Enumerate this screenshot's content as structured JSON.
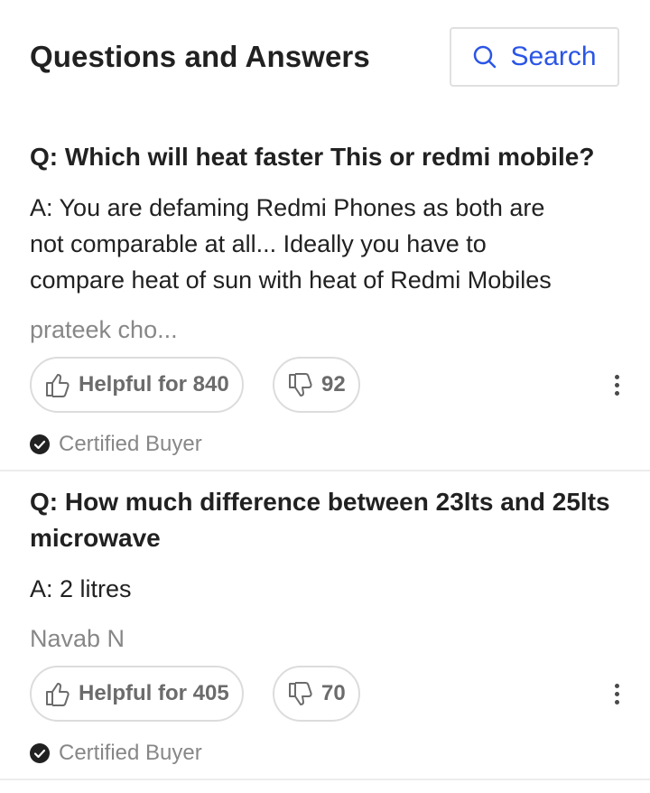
{
  "header": {
    "title": "Questions and Answers",
    "search_label": "Search"
  },
  "qa": [
    {
      "question": "Q: Which will heat faster This or redmi mobile?",
      "answer_lines": [
        "A: You are defaming Redmi Phones as both are",
        "not comparable at all... Ideally you have to",
        "compare heat of sun with heat of Redmi Mobiles"
      ],
      "author": "prateek cho...",
      "helpful_label": "Helpful for 840",
      "dislike_count": "92",
      "certified_label": "Certified Buyer"
    },
    {
      "question_lines": [
        "Q: How much difference between 23lts and 25lts",
        "microwave"
      ],
      "answer": "A: 2 litres",
      "author": "Navab N",
      "helpful_label": "Helpful for 405",
      "dislike_count": "70",
      "certified_label": "Certified Buyer"
    }
  ],
  "colors": {
    "accent": "#2a55e5",
    "text_primary": "#212121",
    "text_secondary": "#878787",
    "border": "#dcdcdc"
  },
  "icons": {
    "search": "search-icon",
    "helpful": "thumbs-up-icon",
    "dislike": "thumbs-down-icon",
    "more": "more-vertical-icon",
    "certified": "check-circle-icon"
  }
}
